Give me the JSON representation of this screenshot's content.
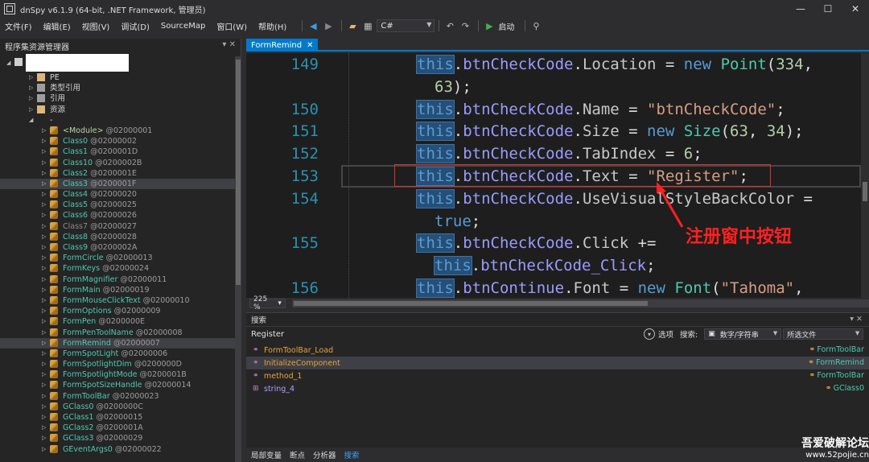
{
  "window": {
    "title": "dnSpy v6.1.9 (64-bit, .NET Framework, 管理员)",
    "minimize": "—",
    "maximize": "☐",
    "close": "✕"
  },
  "menu": [
    "文件(F)",
    "编辑(E)",
    "视图(V)",
    "调试(D)",
    "SourceMap",
    "窗口(W)",
    "帮助(H)"
  ],
  "toolbar": {
    "language": "C#",
    "start_label": "启动"
  },
  "explorer": {
    "title": "程序集资源管理器",
    "nodes": [
      {
        "label": "PE",
        "kind": "folder",
        "indent": 1
      },
      {
        "label": "类型引用",
        "kind": "ref",
        "indent": 1
      },
      {
        "label": "引用",
        "kind": "ref",
        "indent": 1
      },
      {
        "label": "资源",
        "kind": "folder",
        "indent": 1
      },
      {
        "label": "-",
        "kind": "ns",
        "indent": 1
      }
    ],
    "types": [
      {
        "name": "<Module>",
        "token": "@02000001",
        "style": "mod"
      },
      {
        "name": "Class0",
        "token": "@02000002"
      },
      {
        "name": "Class1",
        "token": "@0200001D"
      },
      {
        "name": "Class10",
        "token": "@0200002B"
      },
      {
        "name": "Class2",
        "token": "@0200001E"
      },
      {
        "name": "Class3",
        "token": "@0200001F",
        "selected": true
      },
      {
        "name": "Class4",
        "token": "@02000020"
      },
      {
        "name": "Class5",
        "token": "@02000025"
      },
      {
        "name": "Class6",
        "token": "@02000026"
      },
      {
        "name": "Class7",
        "token": "@02000027",
        "style": "gray"
      },
      {
        "name": "Class8",
        "token": "@02000028"
      },
      {
        "name": "Class9",
        "token": "@0200002A"
      },
      {
        "name": "FormCircle",
        "token": "@02000013"
      },
      {
        "name": "FormKeys",
        "token": "@02000024"
      },
      {
        "name": "FormMagnifier",
        "token": "@02000011"
      },
      {
        "name": "FormMain",
        "token": "@02000019"
      },
      {
        "name": "FormMouseClickText",
        "token": "@02000010"
      },
      {
        "name": "FormOptions",
        "token": "@02000009"
      },
      {
        "name": "FormPen",
        "token": "@0200000E"
      },
      {
        "name": "FormPenToolName",
        "token": "@02000008"
      },
      {
        "name": "FormRemind",
        "token": "@02000007",
        "selected": true
      },
      {
        "name": "FormSpotLight",
        "token": "@02000006"
      },
      {
        "name": "FormSpotlightDim",
        "token": "@0200000D"
      },
      {
        "name": "FormSpotlightMode",
        "token": "@0200001B"
      },
      {
        "name": "FormSpotSizeHandle",
        "token": "@02000014"
      },
      {
        "name": "FormToolBar",
        "token": "@02000023"
      },
      {
        "name": "GClass0",
        "token": "@0200000C"
      },
      {
        "name": "GClass1",
        "token": "@02000015"
      },
      {
        "name": "GClass2",
        "token": "@0200001A"
      },
      {
        "name": "GClass3",
        "token": "@02000029"
      },
      {
        "name": "GEventArgs0",
        "token": "@02000022"
      }
    ]
  },
  "editor": {
    "tab": "FormRemind",
    "lines": [
      {
        "ln": "149",
        "indent": 0,
        "parts": [
          [
            "thisb",
            "this"
          ],
          [
            "plain",
            "."
          ],
          [
            "mem",
            "btnCheckCode"
          ],
          [
            "plain",
            "."
          ],
          [
            "prop",
            "Location"
          ],
          [
            "plain",
            " = "
          ],
          [
            "kw",
            "new"
          ],
          [
            "plain",
            " "
          ],
          [
            "type",
            "Point"
          ],
          [
            "plain",
            "("
          ],
          [
            "num",
            "334"
          ],
          [
            "plain",
            ","
          ]
        ]
      },
      {
        "ln": "",
        "indent": 1,
        "parts": [
          [
            "num",
            "63"
          ],
          [
            "plain",
            ");"
          ]
        ]
      },
      {
        "ln": "150",
        "indent": 0,
        "parts": [
          [
            "thisb",
            "this"
          ],
          [
            "plain",
            "."
          ],
          [
            "mem",
            "btnCheckCode"
          ],
          [
            "plain",
            "."
          ],
          [
            "prop",
            "Name"
          ],
          [
            "plain",
            " = "
          ],
          [
            "str",
            "\"btnCheckCode\""
          ],
          [
            "plain",
            ";"
          ]
        ]
      },
      {
        "ln": "151",
        "indent": 0,
        "parts": [
          [
            "thisb",
            "this"
          ],
          [
            "plain",
            "."
          ],
          [
            "mem",
            "btnCheckCode"
          ],
          [
            "plain",
            "."
          ],
          [
            "prop",
            "Size"
          ],
          [
            "plain",
            " = "
          ],
          [
            "kw",
            "new"
          ],
          [
            "plain",
            " "
          ],
          [
            "type",
            "Size"
          ],
          [
            "plain",
            "("
          ],
          [
            "num",
            "63"
          ],
          [
            "plain",
            ", "
          ],
          [
            "num",
            "34"
          ],
          [
            "plain",
            ");"
          ]
        ]
      },
      {
        "ln": "152",
        "indent": 0,
        "parts": [
          [
            "thisb",
            "this"
          ],
          [
            "plain",
            "."
          ],
          [
            "mem",
            "btnCheckCode"
          ],
          [
            "plain",
            "."
          ],
          [
            "prop",
            "TabIndex"
          ],
          [
            "plain",
            " = "
          ],
          [
            "num",
            "6"
          ],
          [
            "plain",
            ";"
          ]
        ]
      },
      {
        "ln": "153",
        "indent": 0,
        "current": true,
        "parts": [
          [
            "thisb",
            "this"
          ],
          [
            "plain",
            "."
          ],
          [
            "mem",
            "btnCheckCode"
          ],
          [
            "plain",
            "."
          ],
          [
            "prop",
            "Text"
          ],
          [
            "plain",
            " = "
          ],
          [
            "str",
            "\"Register\""
          ],
          [
            "plain",
            ";"
          ]
        ]
      },
      {
        "ln": "154",
        "indent": 0,
        "parts": [
          [
            "thisb",
            "this"
          ],
          [
            "plain",
            "."
          ],
          [
            "mem",
            "btnCheckCode"
          ],
          [
            "plain",
            "."
          ],
          [
            "prop",
            "UseVisualStyleBackColor"
          ],
          [
            "plain",
            " ="
          ]
        ]
      },
      {
        "ln": "",
        "indent": 1,
        "parts": [
          [
            "kw",
            "true"
          ],
          [
            "plain",
            ";"
          ]
        ]
      },
      {
        "ln": "155",
        "indent": 0,
        "parts": [
          [
            "thisb",
            "this"
          ],
          [
            "plain",
            "."
          ],
          [
            "mem",
            "btnCheckCode"
          ],
          [
            "plain",
            "."
          ],
          [
            "prop",
            "Click"
          ],
          [
            "plain",
            " +="
          ]
        ]
      },
      {
        "ln": "",
        "indent": 1,
        "parts": [
          [
            "thisb",
            "this"
          ],
          [
            "plain",
            "."
          ],
          [
            "mem",
            "btnCheckCode_Click"
          ],
          [
            "plain",
            ";"
          ]
        ]
      },
      {
        "ln": "156",
        "indent": 0,
        "parts": [
          [
            "thisb",
            "this"
          ],
          [
            "plain",
            "."
          ],
          [
            "mem",
            "btnContinue"
          ],
          [
            "plain",
            "."
          ],
          [
            "prop",
            "Font"
          ],
          [
            "plain",
            " = "
          ],
          [
            "kw",
            "new"
          ],
          [
            "plain",
            " "
          ],
          [
            "type",
            "Font"
          ],
          [
            "plain",
            "("
          ],
          [
            "str",
            "\"Tahoma\""
          ],
          [
            "plain",
            ","
          ]
        ]
      }
    ],
    "annotation": "注册窗中按钮",
    "zoom": "225 %"
  },
  "search": {
    "title": "搜索",
    "query": "Register",
    "options_label": "选项",
    "search_label": "搜索:",
    "type_value": "数字/字符串",
    "scope_value": "所选文件",
    "results": [
      {
        "name": "FormToolBar_Load",
        "container": "FormToolBar",
        "icon": "method"
      },
      {
        "name": "InitializeComponent",
        "container": "FormRemind",
        "icon": "method",
        "selected": true
      },
      {
        "name": "method_1",
        "container": "FormToolBar",
        "icon": "method"
      },
      {
        "name": "string_4",
        "container": "GClass0",
        "icon": "field"
      }
    ]
  },
  "bottom_tabs": [
    {
      "label": "局部变量"
    },
    {
      "label": "断点"
    },
    {
      "label": "分析器"
    },
    {
      "label": "搜索",
      "active": true
    }
  ],
  "watermark": {
    "line1": "吾爱破解论坛",
    "line2": "www.52pojie.cn"
  },
  "colors": {
    "accent": "#007acc",
    "annotation": "#ff2020"
  }
}
